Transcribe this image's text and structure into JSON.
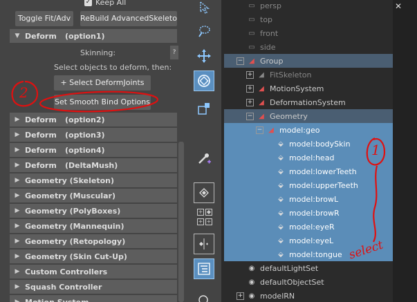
{
  "left": {
    "keep_all": "Keep All",
    "toggle_fit": "Toggle Fit/Adv",
    "rebuild": "ReBuild AdvancedSkeleton",
    "deform_open": {
      "title": "Deform",
      "opt": "(option1)"
    },
    "skinning": "Skinning:",
    "help": "?",
    "select_prompt": "Select objects to deform, then:",
    "select_joints": "+ Select DeformJoints",
    "smooth_bind": "Set Smooth Bind Options",
    "sections": [
      {
        "title": "Deform",
        "opt": "(option2)"
      },
      {
        "title": "Deform",
        "opt": "(option3)"
      },
      {
        "title": "Deform",
        "opt": "(option4)"
      },
      {
        "title": "Deform",
        "opt": "(DeltaMush)"
      },
      {
        "title": "Geometry (Skeleton)",
        "opt": ""
      },
      {
        "title": "Geometry (Muscular)",
        "opt": ""
      },
      {
        "title": "Geometry (PolyBoxes)",
        "opt": ""
      },
      {
        "title": "Geometry (Mannequin)",
        "opt": ""
      },
      {
        "title": "Geometry (Retopology)",
        "opt": ""
      },
      {
        "title": "Geometry (Skin Cut-Up)",
        "opt": ""
      },
      {
        "title": "Custom Controllers",
        "opt": ""
      },
      {
        "title": "Squash Controller",
        "opt": ""
      },
      {
        "title": "Motion System",
        "opt": ""
      }
    ]
  },
  "outliner": {
    "rows": [
      {
        "label": "persp",
        "type": "cam",
        "indent": 0,
        "exp": ""
      },
      {
        "label": "top",
        "type": "cam",
        "indent": 0,
        "exp": ""
      },
      {
        "label": "front",
        "type": "cam",
        "indent": 0,
        "exp": ""
      },
      {
        "label": "side",
        "type": "cam",
        "indent": 0,
        "exp": ""
      },
      {
        "label": "Group",
        "type": "grp",
        "indent": 0,
        "exp": "−"
      },
      {
        "label": "FitSkeleton",
        "type": "dim",
        "indent": 1,
        "exp": "+"
      },
      {
        "label": "MotionSystem",
        "type": "grp",
        "indent": 1,
        "exp": "+"
      },
      {
        "label": "DeformationSystem",
        "type": "grp",
        "indent": 1,
        "exp": "+"
      },
      {
        "label": "Geometry",
        "type": "grp",
        "indent": 1,
        "exp": "−"
      },
      {
        "label": "model:geo",
        "type": "grp",
        "indent": 2,
        "exp": "−"
      },
      {
        "label": "model:bodySkin",
        "type": "mesh",
        "indent": 3,
        "exp": ""
      },
      {
        "label": "model:head",
        "type": "mesh",
        "indent": 3,
        "exp": ""
      },
      {
        "label": "model:lowerTeeth",
        "type": "mesh",
        "indent": 3,
        "exp": ""
      },
      {
        "label": "model:upperTeeth",
        "type": "mesh",
        "indent": 3,
        "exp": ""
      },
      {
        "label": "model:browL",
        "type": "mesh",
        "indent": 3,
        "exp": ""
      },
      {
        "label": "model:browR",
        "type": "mesh",
        "indent": 3,
        "exp": ""
      },
      {
        "label": "model:eyeR",
        "type": "mesh",
        "indent": 3,
        "exp": ""
      },
      {
        "label": "model:eyeL",
        "type": "mesh",
        "indent": 3,
        "exp": ""
      },
      {
        "label": "model:tongue",
        "type": "mesh",
        "indent": 3,
        "exp": ""
      },
      {
        "label": "defaultLightSet",
        "type": "set",
        "indent": 0,
        "exp": ""
      },
      {
        "label": "defaultObjectSet",
        "type": "set",
        "indent": 0,
        "exp": ""
      },
      {
        "label": "modelRN",
        "type": "set",
        "indent": 0,
        "exp": "+"
      }
    ]
  },
  "annotations": {
    "circle2": "2",
    "circle1": "1",
    "select_note": "select"
  },
  "colors": {
    "selected": "#5b8db8",
    "annotation": "#e01010"
  }
}
